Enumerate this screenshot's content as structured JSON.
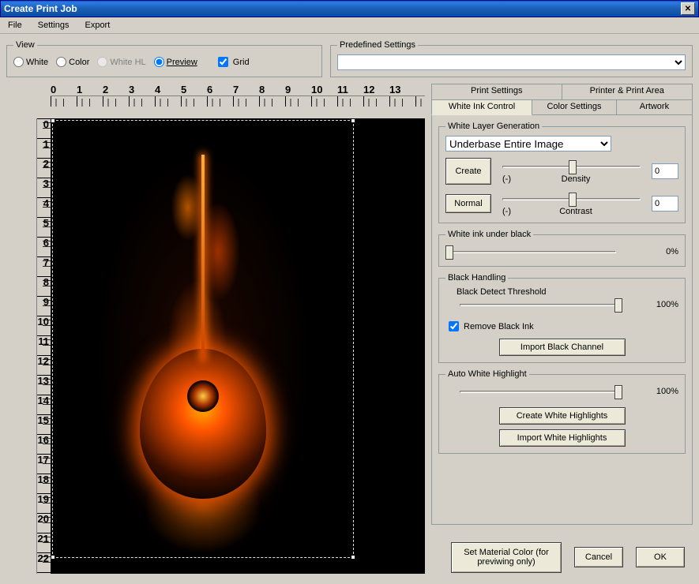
{
  "window": {
    "title": "Create Print Job",
    "close": "X"
  },
  "menu": {
    "file": "File",
    "settings": "Settings",
    "export": "Export"
  },
  "view": {
    "legend": "View",
    "white": "White",
    "color": "Color",
    "whitehl": "White HL",
    "preview": "Preview",
    "grid": "Grid",
    "selected": "preview",
    "grid_checked": true
  },
  "predef": {
    "legend": "Predefined Settings",
    "value": ""
  },
  "ruler": {
    "top": [
      "0",
      "1",
      "2",
      "3",
      "4",
      "5",
      "6",
      "7",
      "8",
      "9",
      "10",
      "11",
      "12",
      "13"
    ],
    "left": [
      "0",
      "1",
      "2",
      "3",
      "4",
      "5",
      "6",
      "7",
      "8",
      "9",
      "10",
      "11",
      "12",
      "13",
      "14",
      "15",
      "16",
      "17",
      "18",
      "19",
      "20",
      "21",
      "22"
    ]
  },
  "tabs": {
    "print_settings": "Print Settings",
    "printer_area": "Printer & Print Area",
    "white_ink": "White Ink Control",
    "color_settings": "Color Settings",
    "artwork": "Artwork",
    "active": "white_ink"
  },
  "wlg": {
    "legend": "White Layer Generation",
    "mode_value": "Underbase Entire Image",
    "create": "Create",
    "normal": "Normal",
    "density_label": "Density",
    "contrast_label": "Contrast",
    "minus": "(-)",
    "density_value": "0",
    "contrast_value": "0"
  },
  "wib": {
    "legend": "White ink under black",
    "value_label": "0%"
  },
  "black": {
    "legend": "Black Handling",
    "threshold_label": "Black Detect Threshold",
    "threshold_value": "100%",
    "remove_black": "Remove Black Ink",
    "remove_checked": true,
    "import_black": "Import Black Channel"
  },
  "awh": {
    "legend": "Auto White Highlight",
    "value_label": "100%",
    "create_hl": "Create White Highlights",
    "import_hl": "Import White Highlights"
  },
  "bottom": {
    "material": "Set Material Color (for previwing only)",
    "cancel": "Cancel",
    "ok": "OK"
  }
}
